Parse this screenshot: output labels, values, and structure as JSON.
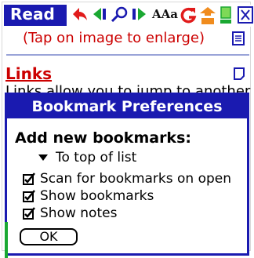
{
  "toolbar": {
    "read_label": "Read",
    "icons": [
      "back-arrow-icon",
      "prev-icon",
      "search-icon",
      "next-icon",
      "font-icon",
      "sync-icon",
      "bookmark-icon",
      "notes-icon",
      "close-icon"
    ],
    "font_label": "AAa"
  },
  "document": {
    "tap_text": "(Tap on image to enlarge)",
    "heading": "Links",
    "body_line": "Links allow you to jump to another"
  },
  "dialog": {
    "title": "Bookmark Preferences",
    "heading": "Add new bookmarks:",
    "dropdown_value": "To top of list",
    "options": [
      {
        "label": "Scan for bookmarks on open",
        "checked": true
      },
      {
        "label": "Show bookmarks",
        "checked": true
      },
      {
        "label": "Show notes",
        "checked": true
      }
    ],
    "ok_label": "OK"
  },
  "colors": {
    "accent": "#1a1ab0",
    "heading_red": "#cc0000",
    "icon_green": "#1aa832",
    "icon_orange": "#f08c1e"
  }
}
